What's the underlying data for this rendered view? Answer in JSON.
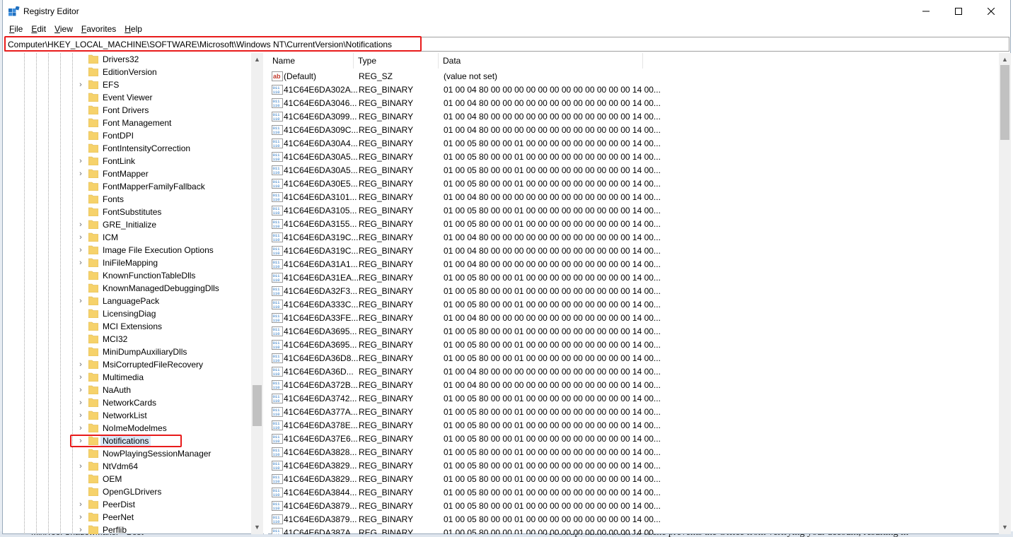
{
  "window": {
    "title": "Registry Editor"
  },
  "menu": [
    {
      "first": "F",
      "rest": "ile"
    },
    {
      "first": "E",
      "rest": "dit"
    },
    {
      "first": "V",
      "rest": "iew"
    },
    {
      "first": "F",
      "rest": "avorites"
    },
    {
      "first": "H",
      "rest": "elp"
    }
  ],
  "address": {
    "path": "Computer\\HKEY_LOCAL_MACHINE\\SOFTWARE\\Microsoft\\Windows NT\\CurrentVersion\\Notifications"
  },
  "tree": {
    "items": [
      {
        "label": "Drivers32",
        "expandable": false
      },
      {
        "label": "EditionVersion",
        "expandable": false
      },
      {
        "label": "EFS",
        "expandable": true
      },
      {
        "label": "Event Viewer",
        "expandable": false
      },
      {
        "label": "Font Drivers",
        "expandable": false
      },
      {
        "label": "Font Management",
        "expandable": false
      },
      {
        "label": "FontDPI",
        "expandable": false
      },
      {
        "label": "FontIntensityCorrection",
        "expandable": false
      },
      {
        "label": "FontLink",
        "expandable": true
      },
      {
        "label": "FontMapper",
        "expandable": true
      },
      {
        "label": "FontMapperFamilyFallback",
        "expandable": false
      },
      {
        "label": "Fonts",
        "expandable": false
      },
      {
        "label": "FontSubstitutes",
        "expandable": false
      },
      {
        "label": "GRE_Initialize",
        "expandable": true
      },
      {
        "label": "ICM",
        "expandable": true
      },
      {
        "label": "Image File Execution Options",
        "expandable": true
      },
      {
        "label": "IniFileMapping",
        "expandable": true
      },
      {
        "label": "KnownFunctionTableDlls",
        "expandable": false
      },
      {
        "label": "KnownManagedDebuggingDlls",
        "expandable": false
      },
      {
        "label": "LanguagePack",
        "expandable": true
      },
      {
        "label": "LicensingDiag",
        "expandable": false
      },
      {
        "label": "MCI Extensions",
        "expandable": false
      },
      {
        "label": "MCI32",
        "expandable": false
      },
      {
        "label": "MiniDumpAuxiliaryDlls",
        "expandable": false
      },
      {
        "label": "MsiCorruptedFileRecovery",
        "expandable": true
      },
      {
        "label": "Multimedia",
        "expandable": true
      },
      {
        "label": "NaAuth",
        "expandable": true
      },
      {
        "label": "NetworkCards",
        "expandable": true
      },
      {
        "label": "NetworkList",
        "expandable": true
      },
      {
        "label": "NoImeModelmes",
        "expandable": true
      },
      {
        "label": "Notifications",
        "expandable": true,
        "selected": true
      },
      {
        "label": "NowPlayingSessionManager",
        "expandable": false
      },
      {
        "label": "NtVdm64",
        "expandable": true
      },
      {
        "label": "OEM",
        "expandable": false
      },
      {
        "label": "OpenGLDrivers",
        "expandable": false
      },
      {
        "label": "PeerDist",
        "expandable": true
      },
      {
        "label": "PeerNet",
        "expandable": true
      },
      {
        "label": "Perflib",
        "expandable": true
      }
    ]
  },
  "list": {
    "columns": [
      "Name",
      "Type",
      "Data"
    ],
    "rows": [
      {
        "icon": "string-value-icon",
        "name": "(Default)",
        "type": "REG_SZ",
        "data": "(value not set)"
      },
      {
        "icon": "binary-value-icon",
        "name": "41C64E6DA302A...",
        "type": "REG_BINARY",
        "data": "01 00 04 80 00 00 00 00 00 00 00 00 00 00 00 00 14 00..."
      },
      {
        "icon": "binary-value-icon",
        "name": "41C64E6DA3046...",
        "type": "REG_BINARY",
        "data": "01 00 04 80 00 00 00 00 00 00 00 00 00 00 00 00 14 00..."
      },
      {
        "icon": "binary-value-icon",
        "name": "41C64E6DA3099...",
        "type": "REG_BINARY",
        "data": "01 00 04 80 00 00 00 00 00 00 00 00 00 00 00 00 14 00..."
      },
      {
        "icon": "binary-value-icon",
        "name": "41C64E6DA309C...",
        "type": "REG_BINARY",
        "data": "01 00 04 80 00 00 00 00 00 00 00 00 00 00 00 00 14 00..."
      },
      {
        "icon": "binary-value-icon",
        "name": "41C64E6DA30A4...",
        "type": "REG_BINARY",
        "data": "01 00 05 80 00 00 01 00 00 00 00 00 00 00 00 00 14 00..."
      },
      {
        "icon": "binary-value-icon",
        "name": "41C64E6DA30A5...",
        "type": "REG_BINARY",
        "data": "01 00 05 80 00 00 01 00 00 00 00 00 00 00 00 00 14 00..."
      },
      {
        "icon": "binary-value-icon",
        "name": "41C64E6DA30A5...",
        "type": "REG_BINARY",
        "data": "01 00 05 80 00 00 01 00 00 00 00 00 00 00 00 00 14 00..."
      },
      {
        "icon": "binary-value-icon",
        "name": "41C64E6DA30E5...",
        "type": "REG_BINARY",
        "data": "01 00 05 80 00 00 01 00 00 00 00 00 00 00 00 00 14 00..."
      },
      {
        "icon": "binary-value-icon",
        "name": "41C64E6DA3101...",
        "type": "REG_BINARY",
        "data": "01 00 04 80 00 00 00 00 00 00 00 00 00 00 00 00 14 00..."
      },
      {
        "icon": "binary-value-icon",
        "name": "41C64E6DA3105...",
        "type": "REG_BINARY",
        "data": "01 00 05 80 00 00 01 00 00 00 00 00 00 00 00 00 14 00..."
      },
      {
        "icon": "binary-value-icon",
        "name": "41C64E6DA3155...",
        "type": "REG_BINARY",
        "data": "01 00 05 80 00 00 01 00 00 00 00 00 00 00 00 00 14 00..."
      },
      {
        "icon": "binary-value-icon",
        "name": "41C64E6DA319C...",
        "type": "REG_BINARY",
        "data": "01 00 04 80 00 00 00 00 00 00 00 00 00 00 00 00 14 00..."
      },
      {
        "icon": "binary-value-icon",
        "name": "41C64E6DA319C...",
        "type": "REG_BINARY",
        "data": "01 00 04 80 00 00 00 00 00 00 00 00 00 00 00 00 14 00..."
      },
      {
        "icon": "binary-value-icon",
        "name": "41C64E6DA31A1...",
        "type": "REG_BINARY",
        "data": "01 00 04 80 00 00 00 00 00 00 00 00 00 00 00 00 14 00..."
      },
      {
        "icon": "binary-value-icon",
        "name": "41C64E6DA31EA...",
        "type": "REG_BINARY",
        "data": "01 00 05 80 00 00 01 00 00 00 00 00 00 00 00 00 14 00..."
      },
      {
        "icon": "binary-value-icon",
        "name": "41C64E6DA32F3...",
        "type": "REG_BINARY",
        "data": "01 00 05 80 00 00 01 00 00 00 00 00 00 00 00 00 14 00..."
      },
      {
        "icon": "binary-value-icon",
        "name": "41C64E6DA333C...",
        "type": "REG_BINARY",
        "data": "01 00 05 80 00 00 01 00 00 00 00 00 00 00 00 00 14 00..."
      },
      {
        "icon": "binary-value-icon",
        "name": "41C64E6DA33FE...",
        "type": "REG_BINARY",
        "data": "01 00 04 80 00 00 00 00 00 00 00 00 00 00 00 00 14 00..."
      },
      {
        "icon": "binary-value-icon",
        "name": "41C64E6DA3695...",
        "type": "REG_BINARY",
        "data": "01 00 05 80 00 00 01 00 00 00 00 00 00 00 00 00 14 00..."
      },
      {
        "icon": "binary-value-icon",
        "name": "41C64E6DA3695...",
        "type": "REG_BINARY",
        "data": "01 00 05 80 00 00 01 00 00 00 00 00 00 00 00 00 14 00..."
      },
      {
        "icon": "binary-value-icon",
        "name": "41C64E6DA36D8...",
        "type": "REG_BINARY",
        "data": "01 00 05 80 00 00 01 00 00 00 00 00 00 00 00 00 14 00..."
      },
      {
        "icon": "binary-value-icon",
        "name": "41C64E6DA36D...",
        "type": "REG_BINARY",
        "data": "01 00 04 80 00 00 00 00 00 00 00 00 00 00 00 00 14 00..."
      },
      {
        "icon": "binary-value-icon",
        "name": "41C64E6DA372B...",
        "type": "REG_BINARY",
        "data": "01 00 04 80 00 00 00 00 00 00 00 00 00 00 00 00 14 00..."
      },
      {
        "icon": "binary-value-icon",
        "name": "41C64E6DA3742...",
        "type": "REG_BINARY",
        "data": "01 00 05 80 00 00 01 00 00 00 00 00 00 00 00 00 14 00..."
      },
      {
        "icon": "binary-value-icon",
        "name": "41C64E6DA377A...",
        "type": "REG_BINARY",
        "data": "01 00 05 80 00 00 01 00 00 00 00 00 00 00 00 00 14 00..."
      },
      {
        "icon": "binary-value-icon",
        "name": "41C64E6DA378E...",
        "type": "REG_BINARY",
        "data": "01 00 05 80 00 00 01 00 00 00 00 00 00 00 00 00 14 00..."
      },
      {
        "icon": "binary-value-icon",
        "name": "41C64E6DA37E6...",
        "type": "REG_BINARY",
        "data": "01 00 05 80 00 00 01 00 00 00 00 00 00 00 00 00 14 00..."
      },
      {
        "icon": "binary-value-icon",
        "name": "41C64E6DA3828...",
        "type": "REG_BINARY",
        "data": "01 00 05 80 00 00 01 00 00 00 00 00 00 00 00 00 14 00..."
      },
      {
        "icon": "binary-value-icon",
        "name": "41C64E6DA3829...",
        "type": "REG_BINARY",
        "data": "01 00 05 80 00 00 01 00 00 00 00 00 00 00 00 00 14 00..."
      },
      {
        "icon": "binary-value-icon",
        "name": "41C64E6DA3829...",
        "type": "REG_BINARY",
        "data": "01 00 05 80 00 00 01 00 00 00 00 00 00 00 00 00 14 00..."
      },
      {
        "icon": "binary-value-icon",
        "name": "41C64E6DA3844...",
        "type": "REG_BINARY",
        "data": "01 00 05 80 00 00 01 00 00 00 00 00 00 00 00 00 14 00..."
      },
      {
        "icon": "binary-value-icon",
        "name": "41C64E6DA3879...",
        "type": "REG_BINARY",
        "data": "01 00 05 80 00 00 01 00 00 00 00 00 00 00 00 00 14 00..."
      },
      {
        "icon": "binary-value-icon",
        "name": "41C64E6DA3879...",
        "type": "REG_BINARY",
        "data": "01 00 05 80 00 00 01 00 00 00 00 00 00 00 00 00 14 00..."
      },
      {
        "icon": "binary-value-icon",
        "name": "41C64E6DA387A...",
        "type": "REG_BINARY",
        "data": "01 00 05 80 00 00 01 00 00 00 00 00 00 00 00 00 14 00..."
      }
    ]
  },
  "background": {
    "left_text": "MiniTool ShadowMaker - Best",
    "right_text": "A corrupt authentication cache prevents the Office from verifying your account, resulting in"
  },
  "colors": {
    "highlight": "#e81b1b",
    "selection": "#d9e8f7",
    "folder": "#f6d26b",
    "icon_blue": "#1f6fbf"
  }
}
